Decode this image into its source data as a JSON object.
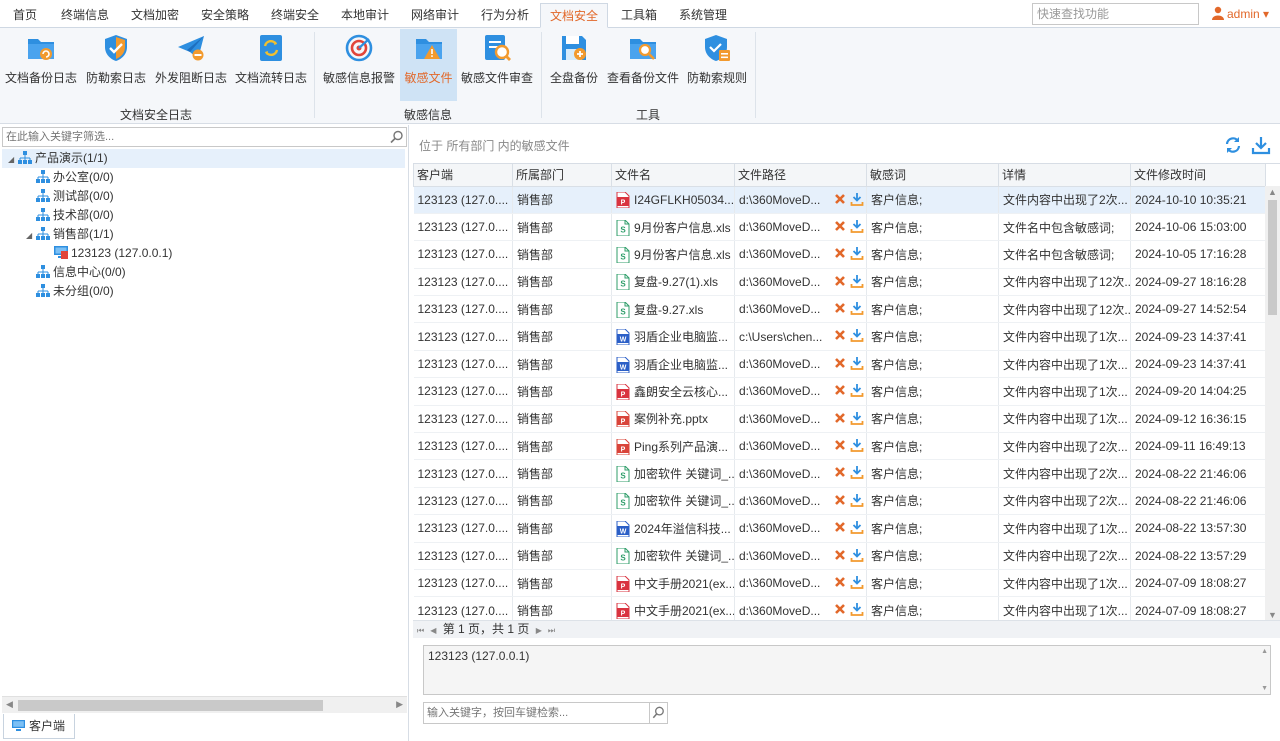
{
  "menu": {
    "tabs": [
      "首页",
      "终端信息",
      "文档加密",
      "安全策略",
      "终端安全",
      "本地审计",
      "网络审计",
      "行为分析",
      "文档安全",
      "工具箱",
      "系统管理"
    ],
    "active_index": 8,
    "search_placeholder": "快速查找功能",
    "user": "admin"
  },
  "ribbon": {
    "buttons": [
      "文档备份日志",
      "防勒索日志",
      "外发阻断日志",
      "文档流转日志",
      "敏感信息报警",
      "敏感文件",
      "敏感文件审查",
      "全盘备份",
      "查看备份文件",
      "防勒索规则"
    ],
    "groups": [
      "文档安全日志",
      "敏感信息",
      "工具"
    ],
    "active_button": "敏感文件"
  },
  "left": {
    "filter_placeholder": "在此输入关键字筛选...",
    "tree": {
      "root": "产品演示(1/1)",
      "depts": [
        "办公室(0/0)",
        "测试部(0/0)",
        "技术部(0/0)",
        "销售部(1/1)"
      ],
      "client": "123123 (127.0.0.1)",
      "others": [
        "信息中心(0/0)",
        "未分组(0/0)"
      ]
    },
    "bottom_tab": "客户端"
  },
  "right": {
    "location": "位于 所有部门 内的敏感文件",
    "columns": [
      "客户端",
      "所属部门",
      "文件名",
      "文件路径",
      "敏感词",
      "详情",
      "文件修改时间"
    ],
    "rows": [
      {
        "client": "123123 (127.0....",
        "dept": "销售部",
        "type": "pdf",
        "name": "I24GFLKH05034...",
        "path": "d:\\360MoveD...",
        "word": "客户信息;",
        "detail": "文件内容中出现了2次...",
        "time": "2024-10-10 10:35:21"
      },
      {
        "client": "123123 (127.0....",
        "dept": "销售部",
        "type": "xls",
        "name": "9月份客户信息.xls",
        "path": "d:\\360MoveD...",
        "word": "客户信息;",
        "detail": "文件名中包含敏感词;",
        "time": "2024-10-06 15:03:00"
      },
      {
        "client": "123123 (127.0....",
        "dept": "销售部",
        "type": "xls",
        "name": "9月份客户信息.xls",
        "path": "d:\\360MoveD...",
        "word": "客户信息;",
        "detail": "文件名中包含敏感词;",
        "time": "2024-10-05 17:16:28"
      },
      {
        "client": "123123 (127.0....",
        "dept": "销售部",
        "type": "xls",
        "name": "复盘-9.27(1).xls",
        "path": "d:\\360MoveD...",
        "word": "客户信息;",
        "detail": "文件内容中出现了12次...",
        "time": "2024-09-27 18:16:28"
      },
      {
        "client": "123123 (127.0....",
        "dept": "销售部",
        "type": "xls",
        "name": "复盘-9.27.xls",
        "path": "d:\\360MoveD...",
        "word": "客户信息;",
        "detail": "文件内容中出现了12次...",
        "time": "2024-09-27 14:52:54"
      },
      {
        "client": "123123 (127.0....",
        "dept": "销售部",
        "type": "doc",
        "name": "羽盾企业电脑监...",
        "path": "c:\\Users\\chen...",
        "word": "客户信息;",
        "detail": "文件内容中出现了1次...",
        "time": "2024-09-23 14:37:41"
      },
      {
        "client": "123123 (127.0....",
        "dept": "销售部",
        "type": "doc",
        "name": "羽盾企业电脑监...",
        "path": "d:\\360MoveD...",
        "word": "客户信息;",
        "detail": "文件内容中出现了1次...",
        "time": "2024-09-23 14:37:41"
      },
      {
        "client": "123123 (127.0....",
        "dept": "销售部",
        "type": "pdf",
        "name": "鑫朗安全云核心...",
        "path": "d:\\360MoveD...",
        "word": "客户信息;",
        "detail": "文件内容中出现了1次...",
        "time": "2024-09-20 14:04:25"
      },
      {
        "client": "123123 (127.0....",
        "dept": "销售部",
        "type": "ppt",
        "name": "案例补充.pptx",
        "path": "d:\\360MoveD...",
        "word": "客户信息;",
        "detail": "文件内容中出现了1次...",
        "time": "2024-09-12 16:36:15"
      },
      {
        "client": "123123 (127.0....",
        "dept": "销售部",
        "type": "ppt",
        "name": "Ping系列产品演...",
        "path": "d:\\360MoveD...",
        "word": "客户信息;",
        "detail": "文件内容中出现了2次...",
        "time": "2024-09-11 16:49:13"
      },
      {
        "client": "123123 (127.0....",
        "dept": "销售部",
        "type": "xls",
        "name": "加密软件 关键词_...",
        "path": "d:\\360MoveD...",
        "word": "客户信息;",
        "detail": "文件内容中出现了2次...",
        "time": "2024-08-22 21:46:06"
      },
      {
        "client": "123123 (127.0....",
        "dept": "销售部",
        "type": "xls",
        "name": "加密软件 关键词_...",
        "path": "d:\\360MoveD...",
        "word": "客户信息;",
        "detail": "文件内容中出现了2次...",
        "time": "2024-08-22 21:46:06"
      },
      {
        "client": "123123 (127.0....",
        "dept": "销售部",
        "type": "doc",
        "name": "2024年溢信科技...",
        "path": "d:\\360MoveD...",
        "word": "客户信息;",
        "detail": "文件内容中出现了1次...",
        "time": "2024-08-22 13:57:30"
      },
      {
        "client": "123123 (127.0....",
        "dept": "销售部",
        "type": "xls",
        "name": "加密软件 关键词_...",
        "path": "d:\\360MoveD...",
        "word": "客户信息;",
        "detail": "文件内容中出现了2次...",
        "time": "2024-08-22 13:57:29"
      },
      {
        "client": "123123 (127.0....",
        "dept": "销售部",
        "type": "pdf",
        "name": "中文手册2021(ex...",
        "path": "d:\\360MoveD...",
        "word": "客户信息;",
        "detail": "文件内容中出现了1次...",
        "time": "2024-07-09 18:08:27"
      },
      {
        "client": "123123 (127.0....",
        "dept": "销售部",
        "type": "pdf",
        "name": "中文手册2021(ex...",
        "path": "d:\\360MoveD...",
        "word": "客户信息;",
        "detail": "文件内容中出现了1次...",
        "time": "2024-07-09 18:08:27"
      }
    ],
    "pager": "第 1 页，共 1 页",
    "detail_text": "123123 (127.0.0.1)",
    "keyword_placeholder": "输入关键字，按回车键检索..."
  },
  "colors": {
    "accent": "#e2682a",
    "selected_row": "#e6f0fb",
    "icon_blue": "#2e8fe0",
    "xls": "#2f9e6a",
    "doc": "#2b5fc7",
    "pdf": "#d9333f",
    "ppt": "#d9443a"
  }
}
